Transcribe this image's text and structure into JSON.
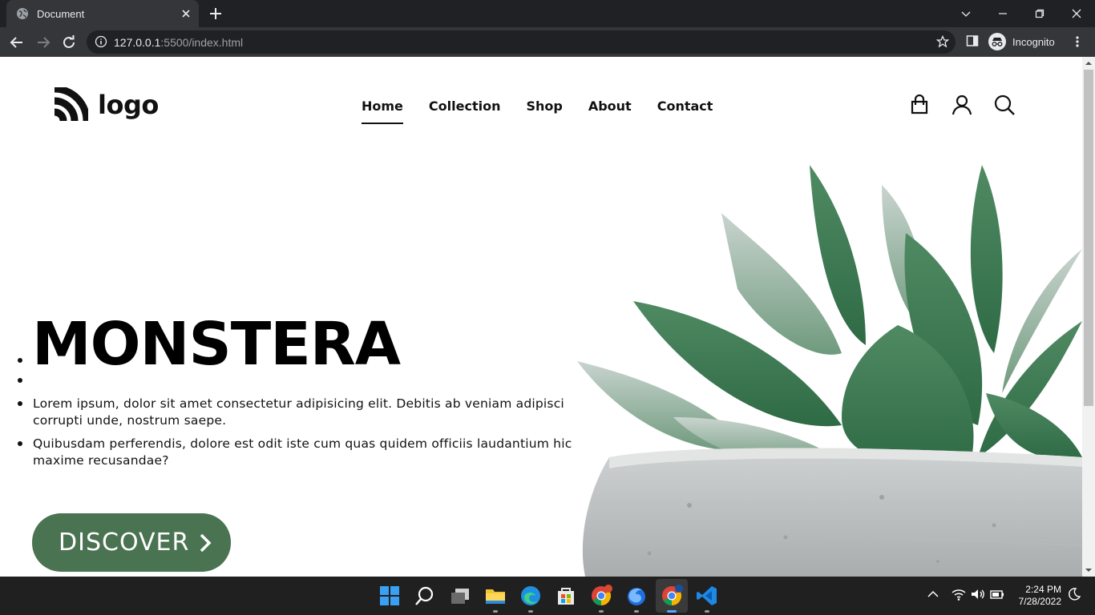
{
  "browser": {
    "tab_title": "Document",
    "url_host": "127.0.0.1",
    "url_path": ":5500/index.html",
    "profile_label": "Incognito"
  },
  "site": {
    "logo_text": "logo",
    "nav": [
      {
        "label": "Home",
        "active": true
      },
      {
        "label": "Collection",
        "active": false
      },
      {
        "label": "Shop",
        "active": false
      },
      {
        "label": "About",
        "active": false
      },
      {
        "label": "Contact",
        "active": false
      }
    ],
    "header_icons": [
      "shopping-bag-icon",
      "user-icon",
      "search-icon"
    ]
  },
  "hero": {
    "title": "MONSTERA",
    "paragraphs": [
      "Lorem ipsum, dolor sit amet consectetur adipisicing elit. Debitis ab veniam adipisci corrupti unde, nostrum saepe.",
      "Quibusdam perferendis, dolore est odit iste cum quas quidem officiis laudantium hic maxime recusandae?"
    ],
    "cta_label": "DISCOVER",
    "accent_color": "#4a7352"
  },
  "taskbar": {
    "time": "2:24 PM",
    "date": "7/28/2022",
    "apps": [
      "windows-start-icon",
      "search-icon",
      "task-view-icon",
      "file-explorer-icon",
      "edge-icon",
      "store-icon",
      "chrome-icon",
      "firefox-icon",
      "chrome-icon",
      "vscode-icon"
    ]
  }
}
